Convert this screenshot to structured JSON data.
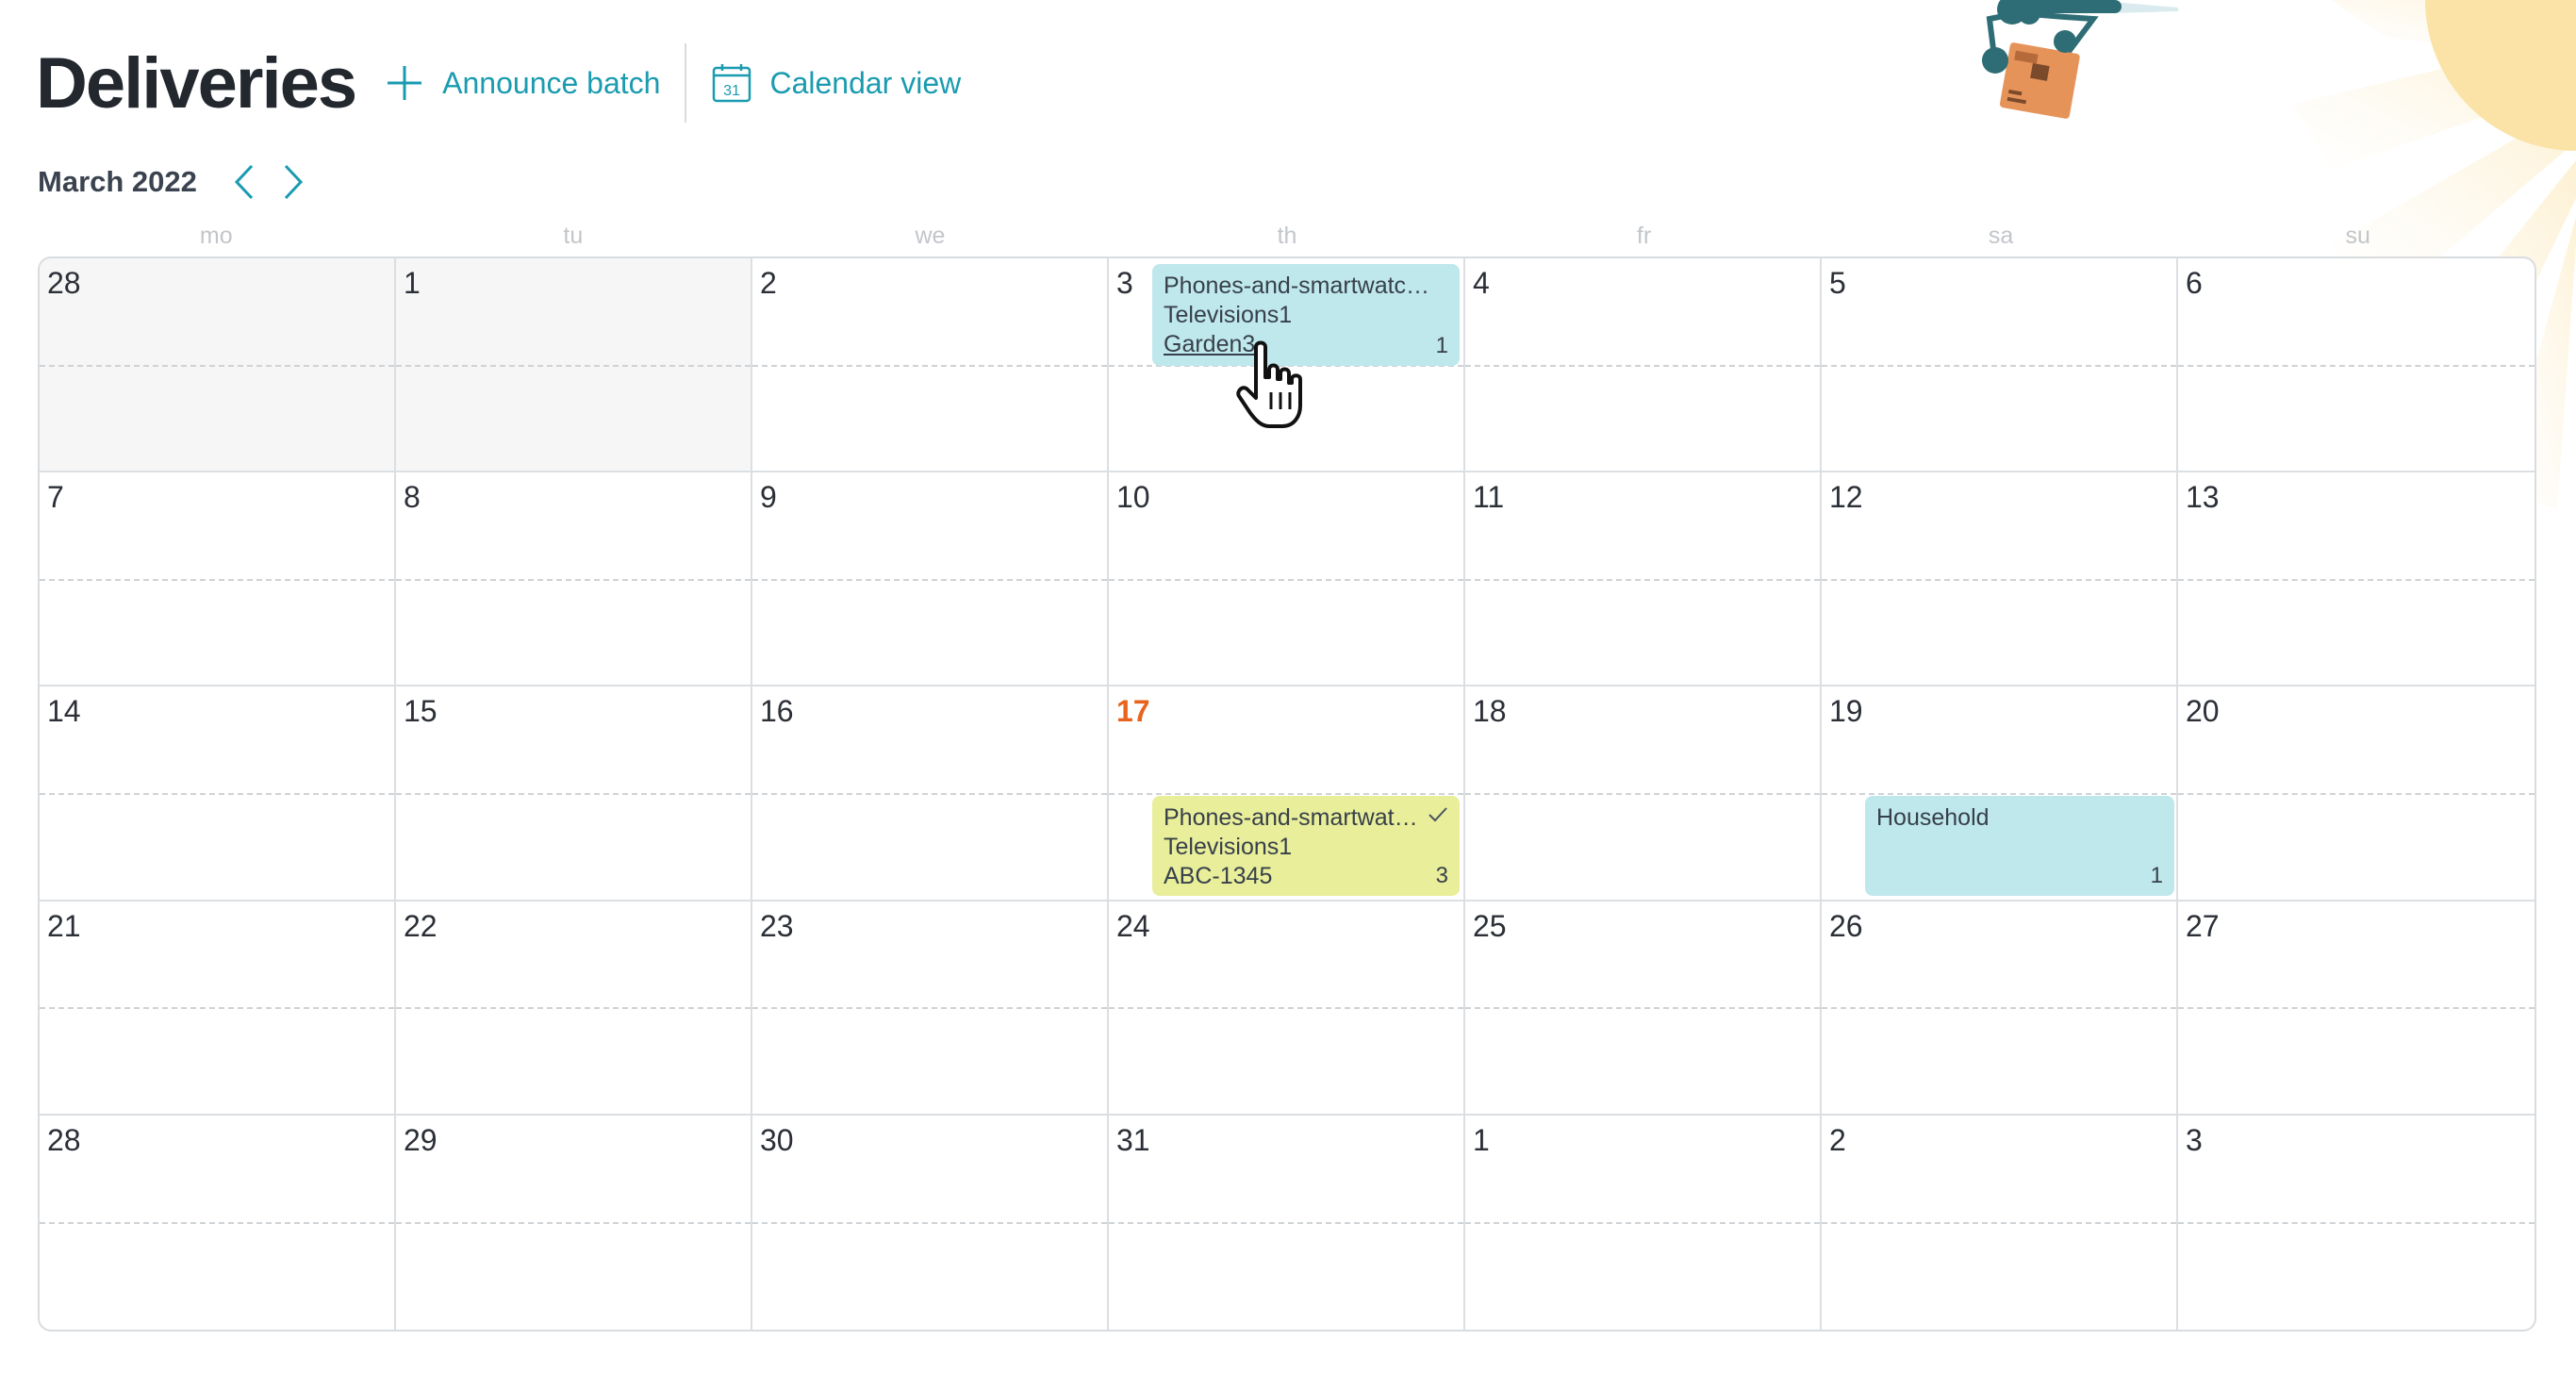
{
  "header": {
    "title": "Deliveries",
    "announce_label": "Announce batch",
    "calendar_label": "Calendar view",
    "calendar_icon_day": "31"
  },
  "month_nav": {
    "label": "March 2022"
  },
  "weekdays": [
    "mo",
    "tu",
    "we",
    "th",
    "fr",
    "sa",
    "su"
  ],
  "weeks": [
    [
      "28",
      "1",
      "2",
      "3",
      "4",
      "5",
      "6"
    ],
    [
      "7",
      "8",
      "9",
      "10",
      "11",
      "12",
      "13"
    ],
    [
      "14",
      "15",
      "16",
      "17",
      "18",
      "19",
      "20"
    ],
    [
      "21",
      "22",
      "23",
      "24",
      "25",
      "26",
      "27"
    ],
    [
      "28",
      "29",
      "30",
      "31",
      "1",
      "2",
      "3"
    ]
  ],
  "deliveries": {
    "mar3": {
      "lines": [
        "Phones-and-smartwatc…",
        "Televisions1",
        "Garden3"
      ],
      "count": "1"
    },
    "mar17": {
      "lines": [
        "Phones-and-smartwatc…",
        "Televisions1",
        "ABC-1345"
      ],
      "count": "3"
    },
    "mar19": {
      "lines": [
        "Household"
      ],
      "count": "1"
    }
  },
  "colors": {
    "accent": "#1a9bb0",
    "today": "#e8641e",
    "card_blue": "#bfe8ec",
    "card_yellow": "#e9ee9a",
    "sun": "#fbe3a8"
  },
  "icons": {
    "announce": "plus-icon",
    "calendar": "calendar-icon",
    "prev": "chevron-left-icon",
    "next": "chevron-right-icon",
    "delivered": "check-icon",
    "cursor": "hand-cursor-icon"
  }
}
